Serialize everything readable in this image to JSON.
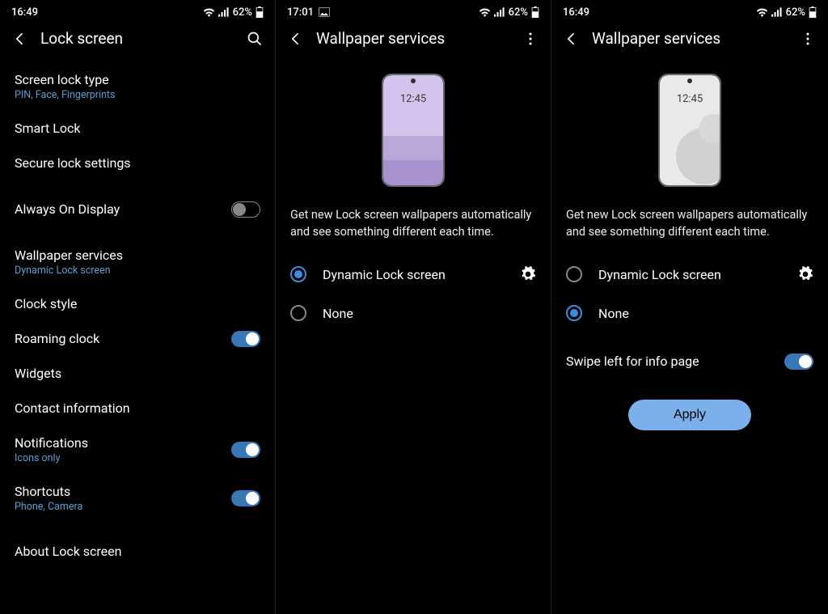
{
  "status": {
    "battery_pct": "62%"
  },
  "col1": {
    "time": "16:49",
    "title": "Lock screen",
    "items": {
      "screen_lock": {
        "label": "Screen lock type",
        "sub": "PIN, Face, Fingerprints"
      },
      "smart_lock": {
        "label": "Smart Lock"
      },
      "secure": {
        "label": "Secure lock settings"
      },
      "aod": {
        "label": "Always On Display",
        "on": false
      },
      "wallpaper": {
        "label": "Wallpaper services",
        "sub": "Dynamic Lock screen"
      },
      "clock_style": {
        "label": "Clock style"
      },
      "roaming": {
        "label": "Roaming clock",
        "on": true
      },
      "widgets": {
        "label": "Widgets"
      },
      "contact": {
        "label": "Contact information"
      },
      "notif": {
        "label": "Notifications",
        "sub": "Icons only",
        "on": true
      },
      "shortcuts": {
        "label": "Shortcuts",
        "sub": "Phone, Camera",
        "on": true
      },
      "about": {
        "label": "About Lock screen"
      }
    }
  },
  "col2": {
    "time": "17:01",
    "title": "Wallpaper services",
    "mock_time": "12:45",
    "desc": "Get new Lock screen wallpapers automatically and see something different each time.",
    "opt_dynamic": "Dynamic Lock screen",
    "opt_none": "None",
    "selected": "dynamic"
  },
  "col3": {
    "time": "16:49",
    "title": "Wallpaper services",
    "mock_time": "12:45",
    "desc": "Get new Lock screen wallpapers automatically and see something different each time.",
    "opt_dynamic": "Dynamic Lock screen",
    "opt_none": "None",
    "selected": "none",
    "swipe_label": "Swipe left for info page",
    "swipe_on": true,
    "apply_label": "Apply"
  }
}
